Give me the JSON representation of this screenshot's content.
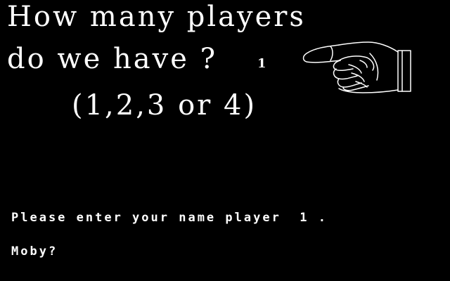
{
  "question": {
    "line1": "How many players",
    "line2": "do we have ?",
    "current_answer": "1",
    "options": "(1,2,3 or 4)"
  },
  "name_entry": {
    "prompt": "Please enter your name player  1 .",
    "input_value": "Moby?"
  },
  "icons": {
    "pointer": "pointing-hand-icon"
  },
  "colors": {
    "background": "#000000",
    "text": "#ffffff"
  }
}
